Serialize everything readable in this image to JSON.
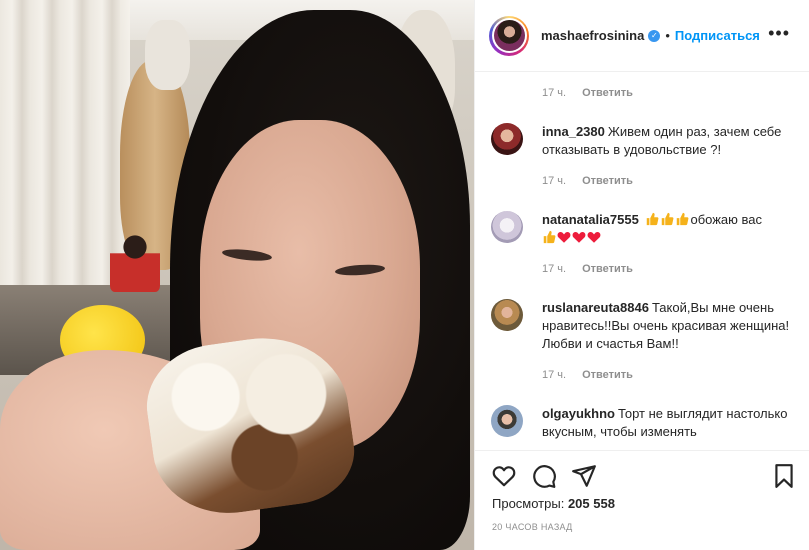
{
  "post": {
    "username": "mashaefrosinina",
    "verified_mark": "✓",
    "separator": "•",
    "follow_label": "Подписаться",
    "more_label": "•••"
  },
  "comments": {
    "caption_meta": {
      "time": "17 ч.",
      "reply": "Ответить"
    },
    "items": [
      {
        "username": "inna_2380",
        "text": "Живем один раз, зачем себе отказывать в удовольствие ?!",
        "time": "17 ч.",
        "reply": "Ответить"
      },
      {
        "username": "natanatalia7555",
        "text_before": "",
        "emojis_line1": [
          "thumbs-up",
          "thumbs-up",
          "thumbs-up"
        ],
        "text_mid": "обожаю вас",
        "emojis_line2": [
          "thumbs-up",
          "heart",
          "heart",
          "heart"
        ],
        "time": "17 ч.",
        "reply": "Ответить"
      },
      {
        "username": "ruslanareuta8846",
        "text": "Такой,Вы мне очень нравитесь!!Вы очень красивая женщина!Любви и счастья Вам!!",
        "time": "17 ч.",
        "reply": "Ответить"
      },
      {
        "username": "olgayukhno",
        "text": "Торт не выглядит настолько вкусным, чтобы изменять"
      }
    ]
  },
  "actions": {
    "views_label": "Просмотры:",
    "views_count": "205 558",
    "time_ago": "20 часов назад"
  },
  "colors": {
    "accent": "#0095f6",
    "muted": "#8e8e8e",
    "text": "#262626",
    "heart": "#ed1c3b",
    "thumb": "#f5b21b"
  }
}
